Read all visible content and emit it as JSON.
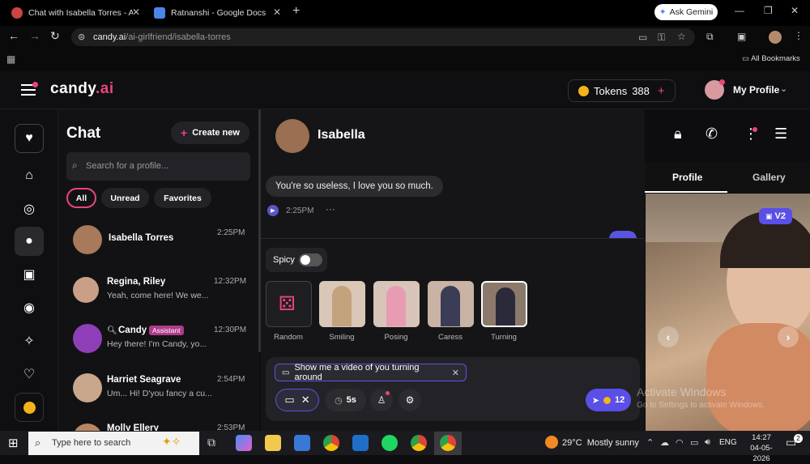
{
  "browser": {
    "tabs": [
      {
        "title": "Chat with Isabella Torres - AI G",
        "color": "#e76c6c"
      },
      {
        "title": "Ratnanshi - Google Docs",
        "color": "#4a86e8"
      }
    ],
    "new_tab_icon": "plus-icon",
    "ask_gemini": "Ask Gemini",
    "url_domain": "candy.ai",
    "url_path": "/ai-girlfriend/isabella-torres",
    "bookmarks_label": "All Bookmarks"
  },
  "app": {
    "logo_main": "candy",
    "logo_suffix": ".ai",
    "tokens_label": "Tokens",
    "tokens_value": "388",
    "profile_label": "My Profile",
    "accent": "#e8457c"
  },
  "chat_list": {
    "title": "Chat",
    "create_label": "Create new",
    "search_placeholder": "Search for a profile...",
    "filters": [
      "All",
      "Unread",
      "Favorites"
    ],
    "items": [
      {
        "name": "Isabella Torres",
        "preview": "",
        "time": "2:25PM",
        "color": "#a67a5b"
      },
      {
        "name": "Regina, Riley",
        "preview": "Yeah, come here! We we...",
        "time": "12:32PM",
        "color": "#c9a087"
      },
      {
        "name": "Candy",
        "badge": "Assistant",
        "preview": "Hey there! I'm Candy, yo...",
        "time": "12:30PM",
        "color": "#8e3fb8"
      },
      {
        "name": "Harriet Seagrave",
        "preview": "Um... Hi! D'you fancy a cu...",
        "time": "2:54PM",
        "color": "#c8a78c"
      },
      {
        "name": "Molly Ellery",
        "preview": "",
        "time": "2:53PM",
        "color": "#b88762"
      }
    ]
  },
  "conversation": {
    "name": "Isabella",
    "message": "You're so useless, I love you so much.",
    "message_time": "2:25PM",
    "spicy_label": "Spicy",
    "poses": [
      "Random",
      "Smiling",
      "Posing",
      "Caress",
      "Turning"
    ],
    "prompt_chip": "Show me a video of you turning around",
    "duration": "5s",
    "send_cost": "12"
  },
  "right_panel": {
    "tabs": [
      "Profile",
      "Gallery"
    ],
    "badge": "V2",
    "watermark_title": "Activate Windows",
    "watermark_sub": "Go to Settings to activate Windows."
  },
  "taskbar": {
    "search_placeholder": "Type here to search",
    "weather": "29°C  Mostly sunny",
    "lang": "ENG",
    "time": "14:27",
    "date": "04-05-2026",
    "notif_count": "2"
  }
}
